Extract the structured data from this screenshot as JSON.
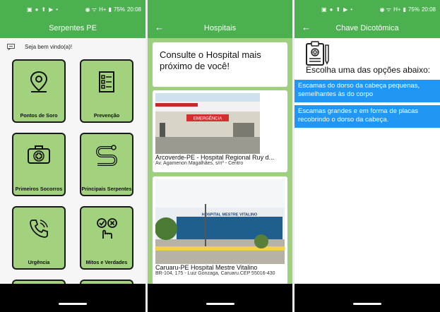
{
  "status": {
    "battery": "75%",
    "time": "20:08",
    "signal": "H+"
  },
  "screen1": {
    "title": "Serpentes PE",
    "welcome": "Seja bem vindo(a)!",
    "tiles": [
      {
        "label": "Pontos de Soro",
        "icon": "map-pin-icon"
      },
      {
        "label": "Prevenção",
        "icon": "checklist-icon"
      },
      {
        "label": "Primeiros Socorros",
        "icon": "first-aid-kit-icon"
      },
      {
        "label": "Principais Serpentes",
        "icon": "snake-icon"
      },
      {
        "label": "Urgência",
        "icon": "phone-call-icon"
      },
      {
        "label": "Mitos e Verdades",
        "icon": "check-cross-hand-icon"
      }
    ]
  },
  "screen2": {
    "title": "Hospitais",
    "intro": "Consulte o Hospital mais próximo de você!",
    "hospitals": [
      {
        "name": "Arcoverde-PE - Hospital Regional Ruy d...",
        "address": "Av. Agamenon Magalhães, s/nº - Centro",
        "sign": "EMERGÊNCIA"
      },
      {
        "name": "Caruaru-PE Hospital Mestre Vitalino",
        "address": "BR-104, 175 - Luiz Gonzaga, Caruaru.CEP 55016-430",
        "sign": "HOSPITAL MESTRE VITALINO"
      }
    ]
  },
  "screen3": {
    "title": "Chave Dicotômica",
    "prompt": "Escolha uma das opções abaixo:",
    "options": [
      "Escamas do dorso da cabeça pequenas, semelhantes às do corpo",
      "Escamas grandes e em forma de placas recobrindo o dorso da cabeça."
    ]
  }
}
